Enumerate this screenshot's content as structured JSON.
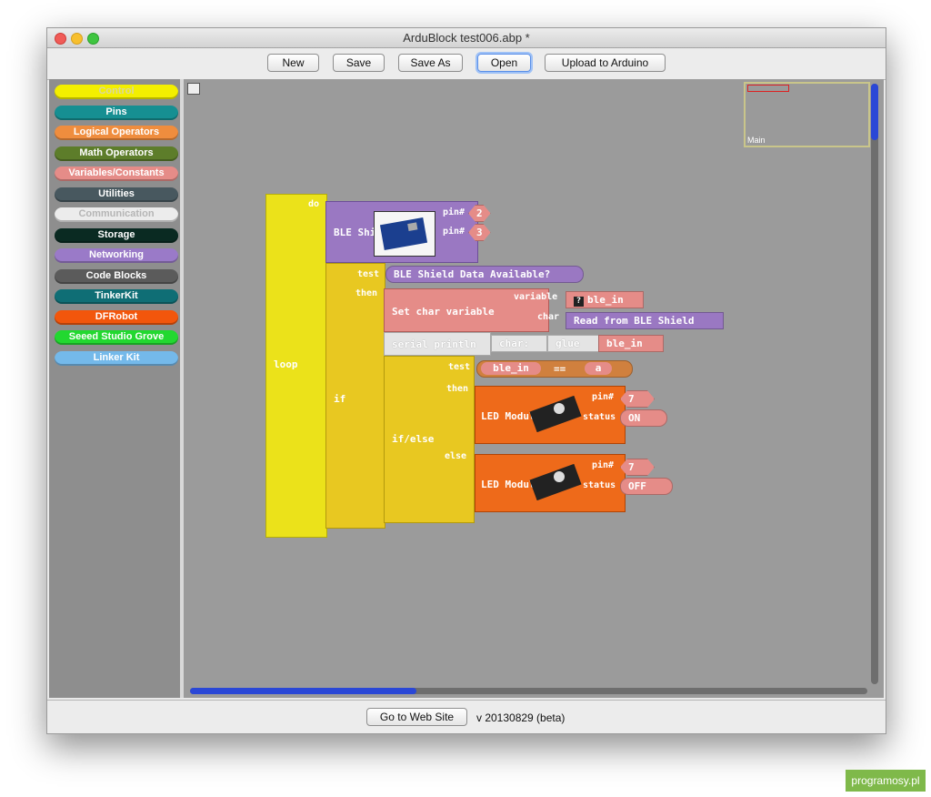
{
  "window": {
    "title": "ArduBlock test006.abp *"
  },
  "toolbar": {
    "new_label": "New",
    "save_label": "Save",
    "save_as_label": "Save As",
    "open_label": "Open",
    "upload_label": "Upload to Arduino"
  },
  "palette": {
    "categories": [
      {
        "label": "Control",
        "color": "#f3ef00"
      },
      {
        "label": "Pins",
        "color": "#168f92"
      },
      {
        "label": "Logical Operators",
        "color": "#ef8d3e"
      },
      {
        "label": "Math Operators",
        "color": "#5d7d2a"
      },
      {
        "label": "Variables/Constants",
        "color": "#e58c88"
      },
      {
        "label": "Utilities",
        "color": "#48585f"
      },
      {
        "label": "Communication",
        "color": "#ececec"
      },
      {
        "label": "Storage",
        "color": "#0a2a22"
      },
      {
        "label": "Networking",
        "color": "#9a7ac8"
      },
      {
        "label": "Code Blocks",
        "color": "#5b5b5b"
      },
      {
        "label": "TinkerKit",
        "color": "#0f6e75"
      },
      {
        "label": "DFRobot",
        "color": "#f2560c"
      },
      {
        "label": "Seeed Studio Grove",
        "color": "#22d830"
      },
      {
        "label": "Linker Kit",
        "color": "#74b9ea"
      }
    ]
  },
  "canvas": {
    "minimap_label": "Main",
    "blocks": {
      "loop": "loop",
      "do": "do",
      "ble_shield": "BLE Shield",
      "pin1": "pin#",
      "pin1_value": "2",
      "pin2": "pin#",
      "pin2_value": "3",
      "if": "if",
      "test": "test",
      "then": "then",
      "ble_available": "BLE Shield Data Available?",
      "set_char": "Set char variable",
      "variable": "variable",
      "var_name": "ble_in",
      "char": "char",
      "read_ble": "Read from BLE Shield",
      "serial_println": "serial println",
      "char_label": "char:",
      "glue": "glue",
      "glue_value": "ble_in",
      "ifelse": "if/else",
      "test2": "test",
      "eq_left": "ble_in",
      "eq_op": "==",
      "eq_right": "a",
      "then2": "then",
      "else": "else",
      "led1": "LED Module",
      "led1_pin": "pin#",
      "led1_pin_value": "7",
      "led1_status": "status",
      "led1_status_value": "ON",
      "led2": "LED Module",
      "led2_pin": "pin#",
      "led2_pin_value": "7",
      "led2_status": "status",
      "led2_status_value": "OFF"
    }
  },
  "statusbar": {
    "web_button": "Go to Web Site",
    "version": "v 20130829 (beta)"
  },
  "watermark": "programosy.pl"
}
